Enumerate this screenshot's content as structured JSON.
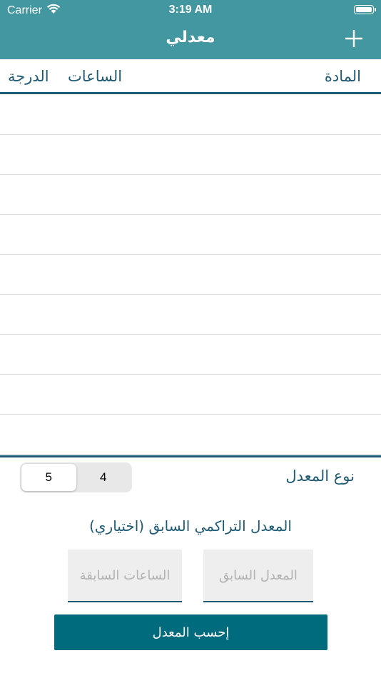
{
  "status_bar": {
    "carrier": "Carrier",
    "time": "3:19 AM",
    "wifi_icon": "wifi-icon",
    "battery_icon": "battery-full-icon"
  },
  "nav": {
    "title": "معدلي",
    "add_icon": "plus-icon"
  },
  "columns": {
    "subject": "المادة",
    "hours": "الساعات",
    "grade": "الدرجة"
  },
  "rows": [
    "",
    "",
    "",
    "",
    "",
    "",
    "",
    "",
    ""
  ],
  "gpa_type": {
    "label": "نوع المعدل",
    "options": [
      "5",
      "4"
    ],
    "selected": "5"
  },
  "previous": {
    "title": "المعدل التراكمي السابق (اختياري)",
    "gpa_placeholder": "المعدل السابق",
    "hours_placeholder": "الساعات السابقة"
  },
  "calculate_label": "إحسب المعدل",
  "colors": {
    "nav_bar": "#4397a1",
    "accent": "#1f5a74",
    "button": "#016b7e"
  }
}
